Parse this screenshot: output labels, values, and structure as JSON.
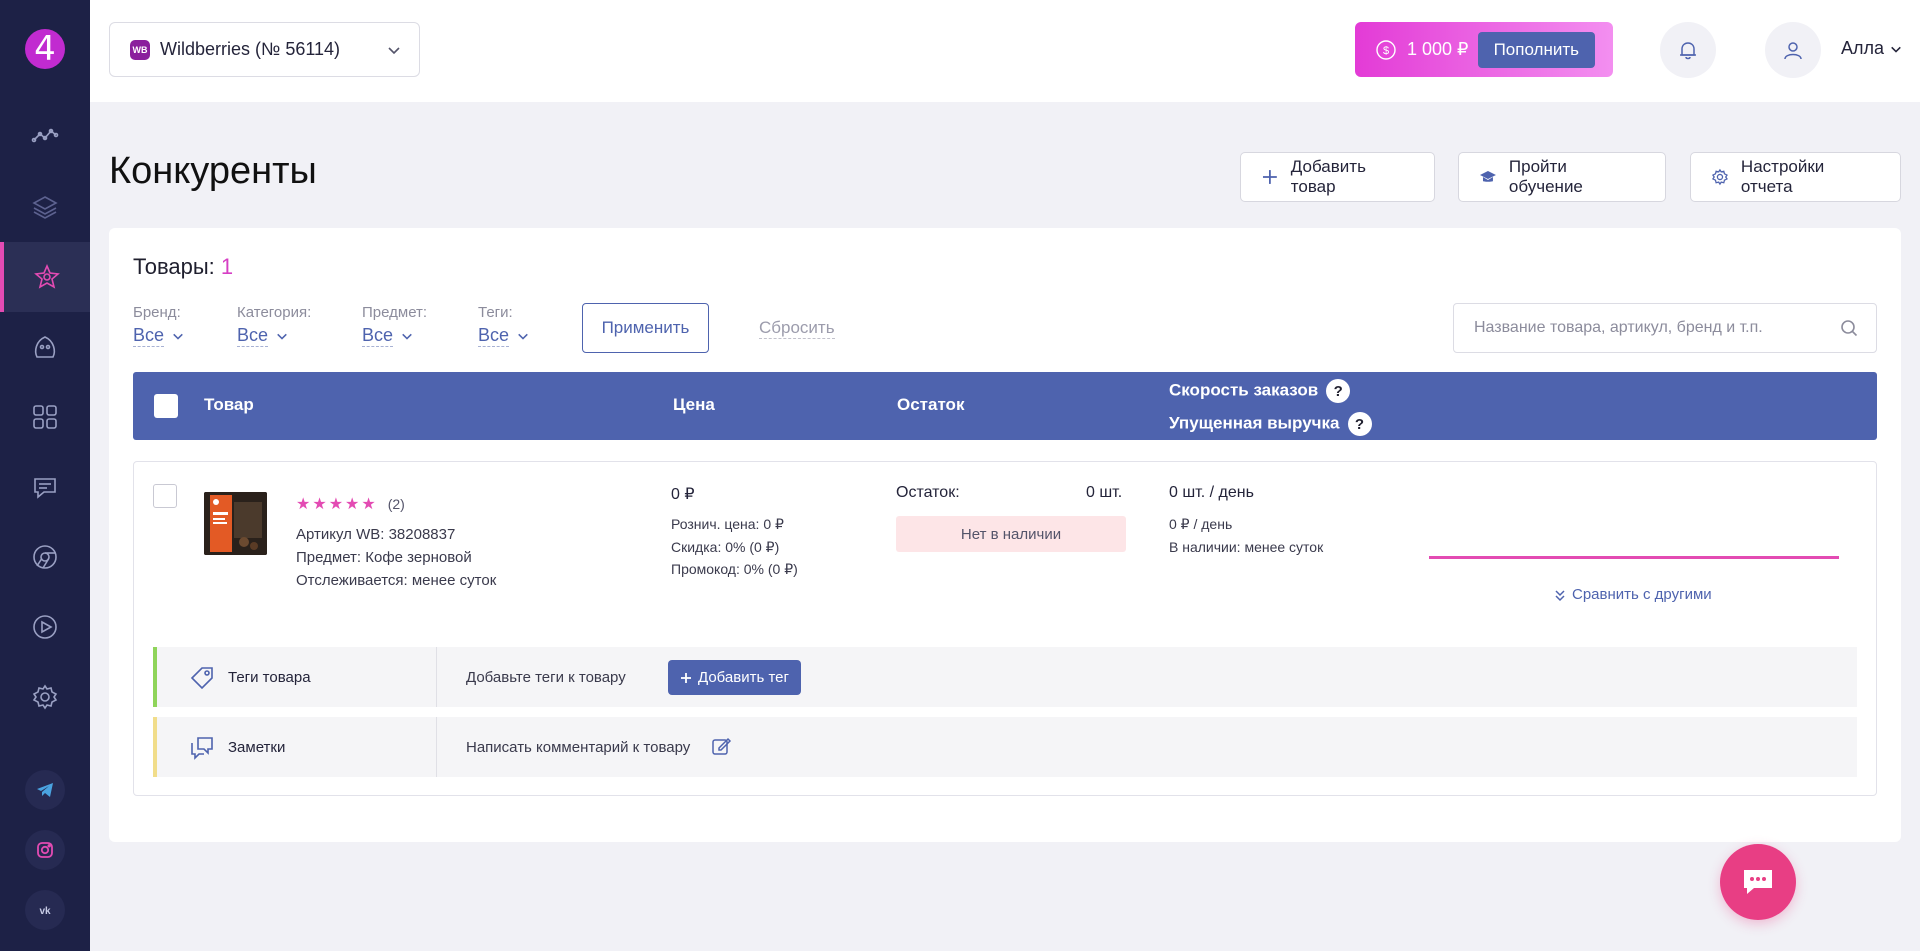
{
  "sidebar": {
    "logo_text": "4",
    "nav_icons": [
      "analytics-icon",
      "layers-icon",
      "star-icon",
      "ghost-icon",
      "grid-icon",
      "chat-icon",
      "chrome-icon",
      "play-icon",
      "gear-icon"
    ],
    "active_index": 2,
    "socials": [
      "telegram-icon",
      "instagram-icon",
      "vk-icon"
    ],
    "colors": {
      "bg": "#1d2146",
      "accent": "#e34bb3"
    }
  },
  "header": {
    "store_badge": "WB",
    "store_name": "Wildberries (№ 56114)",
    "balance": "1 000 ₽",
    "topup_label": "Пополнить",
    "user_name": "Алла"
  },
  "page": {
    "title": "Конкуренты",
    "actions": {
      "add_product": "Добавить товар",
      "training": "Пройти обучение",
      "report_settings": "Настройки отчета"
    }
  },
  "products": {
    "label": "Товары:",
    "count": "1"
  },
  "filters": {
    "brand": {
      "label": "Бренд:",
      "value": "Все"
    },
    "category": {
      "label": "Категория:",
      "value": "Все"
    },
    "subject": {
      "label": "Предмет:",
      "value": "Все"
    },
    "tags": {
      "label": "Теги:",
      "value": "Все"
    },
    "apply_label": "Применить",
    "reset_label": "Сбросить",
    "search_placeholder": "Название товара, артикул, бренд и т.п."
  },
  "table": {
    "headers": {
      "product": "Товар",
      "price": "Цена",
      "stock": "Остаток",
      "order_speed": "Скорость заказов",
      "lost_revenue": "Упущенная выручка"
    },
    "row": {
      "rating_count": "(2)",
      "article": "Артикул WB: 38208837",
      "subject": "Предмет: Кофе зерновой",
      "tracked": "Отслеживается: менее суток",
      "price": "0 ₽",
      "retail_price": "Рознич. цена: 0 ₽",
      "discount": "Скидка: 0% (0 ₽)",
      "promo": "Промокод: 0% (0 ₽)",
      "stock_label": "Остаток:",
      "stock_value": "0 шт.",
      "stock_status": "Нет в наличии",
      "speed": "0 шт. / день",
      "revenue_speed": "0 ₽ / день",
      "in_stock": "В наличии:  менее суток",
      "compare_label": "Сравнить с другими",
      "tags_label": "Теги товара",
      "tags_hint": "Добавьте теги к товару",
      "add_tag_label": "Добавить тег",
      "notes_label": "Заметки",
      "notes_hint": "Написать комментарий к товару"
    }
  }
}
